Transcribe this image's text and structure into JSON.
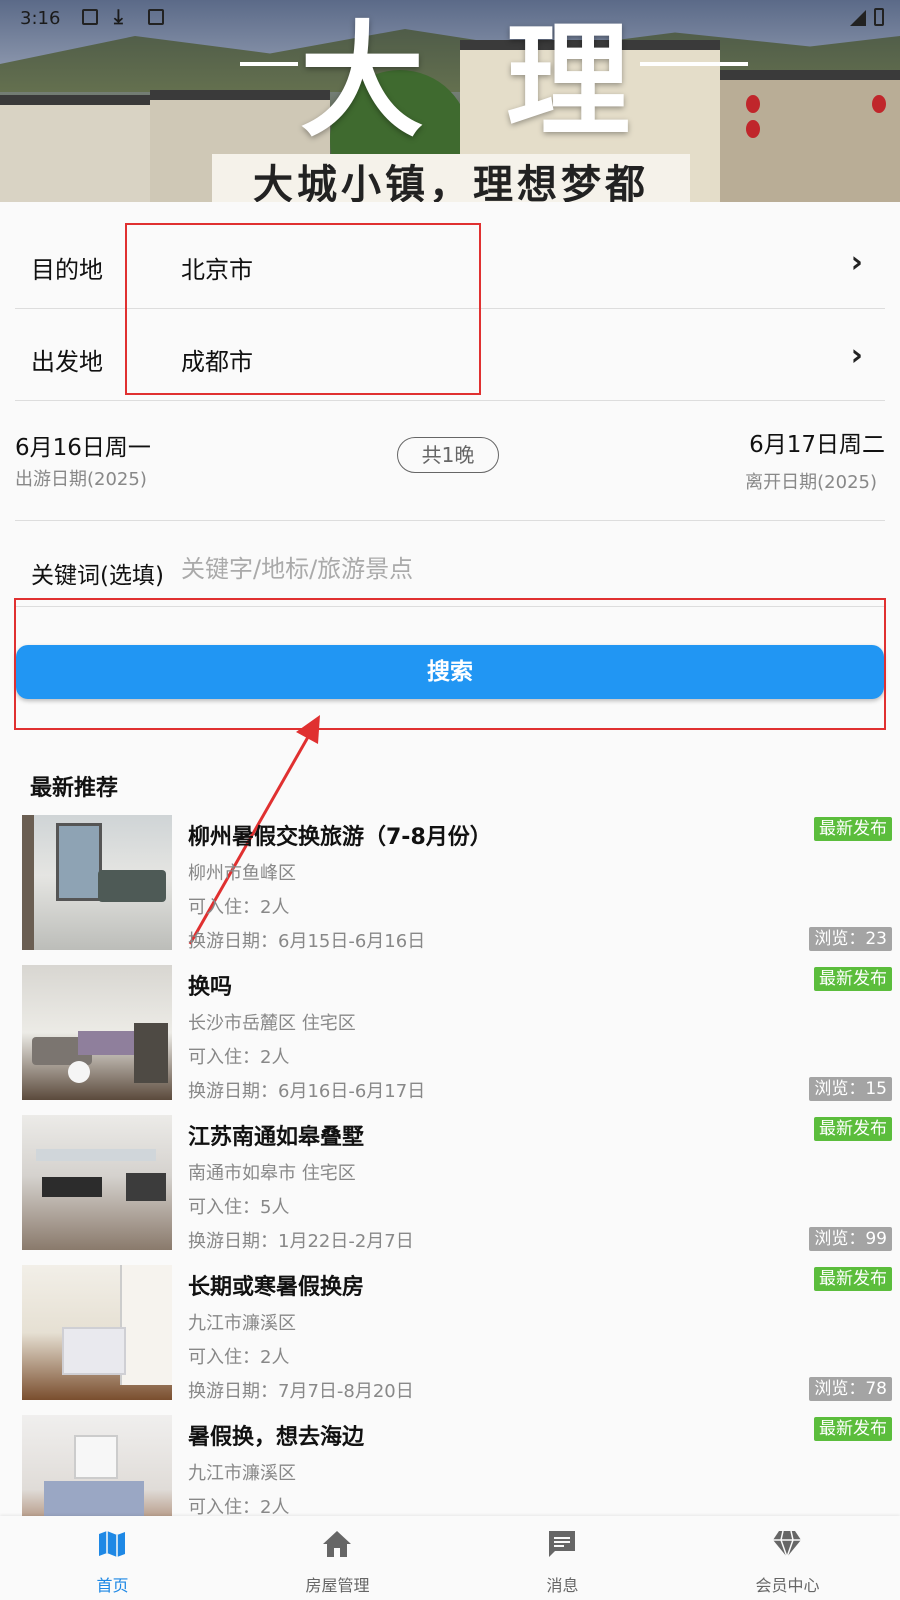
{
  "status_bar": {
    "time": "3:16"
  },
  "banner": {
    "title_chars": [
      "大",
      "理"
    ],
    "slogan": "大城小镇，理想梦都"
  },
  "form": {
    "destination_label": "目的地",
    "destination_value": "北京市",
    "departure_label": "出发地",
    "departure_value": "成都市",
    "start_date": "6月16日周一",
    "start_sub": "出游日期(2025)",
    "nights": "共1晚",
    "end_date": "6月17日周二",
    "end_sub": "离开日期(2025)",
    "keyword_label": "关键词(选填)",
    "keyword_placeholder": "关键字/地标/旅游景点",
    "search_label": "搜索"
  },
  "section_title": "最新推荐",
  "listings": [
    {
      "title": "柳州暑假交换旅游（7-8月份）",
      "location": "柳州市鱼峰区",
      "capacity": "可入住：2人",
      "dates": "换游日期：6月15日-6月16日",
      "badge": "最新发布",
      "views": "浏览：23"
    },
    {
      "title": "换吗",
      "location": "长沙市岳麓区 住宅区",
      "capacity": "可入住：2人",
      "dates": "换游日期：6月16日-6月17日",
      "badge": "最新发布",
      "views": "浏览：15"
    },
    {
      "title": "江苏南通如皋叠墅",
      "location": "南通市如皋市 住宅区",
      "capacity": "可入住：5人",
      "dates": "换游日期：1月22日-2月7日",
      "badge": "最新发布",
      "views": "浏览：99"
    },
    {
      "title": "长期或寒暑假换房",
      "location": "九江市濂溪区",
      "capacity": "可入住：2人",
      "dates": "换游日期：7月7日-8月20日",
      "badge": "最新发布",
      "views": "浏览：78"
    },
    {
      "title": "暑假换，想去海边",
      "location": "九江市濂溪区",
      "capacity": "可入住：2人",
      "dates": "",
      "badge": "最新发布",
      "views": ""
    }
  ],
  "bottom_nav": [
    {
      "label": "首页",
      "icon": "map-icon",
      "active": true
    },
    {
      "label": "房屋管理",
      "icon": "house-icon",
      "active": false
    },
    {
      "label": "消息",
      "icon": "message-icon",
      "active": false
    },
    {
      "label": "会员中心",
      "icon": "diamond-icon",
      "active": false
    }
  ],
  "colors": {
    "accent": "#2196f3",
    "badge_new": "#5bbd3c",
    "badge_views": "#a4a4a4",
    "highlight": "#e03030"
  }
}
